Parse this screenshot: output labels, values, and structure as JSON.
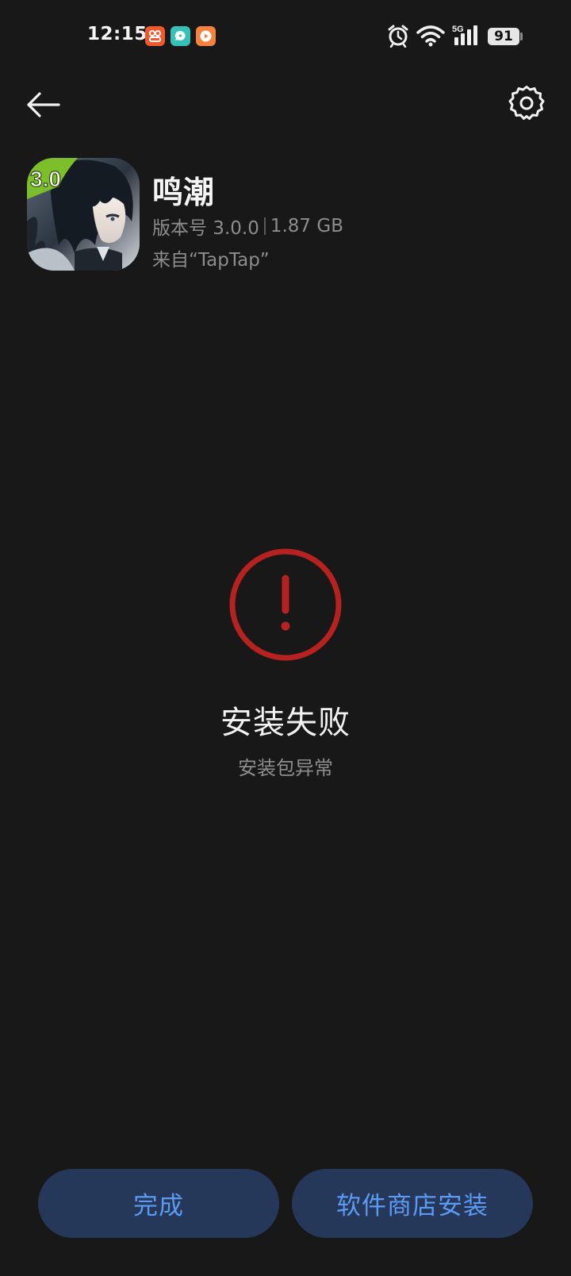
{
  "status_bar": {
    "time": "12:15",
    "network": "5G",
    "battery": "91",
    "notification_icons": [
      "app-notification-icon",
      "chat-notification-icon",
      "video-notification-icon"
    ]
  },
  "toolbar": {
    "back_icon": "arrow-left-icon",
    "settings_icon": "gear-icon"
  },
  "app": {
    "name": "鸣潮",
    "version": "版本号 3.0.0",
    "size": "1.87 GB",
    "source": "来自“TapTap”",
    "icon_badge": "3.0"
  },
  "status": {
    "title": "安装失败",
    "detail": "安装包异常",
    "icon": "error-exclamation-icon",
    "color": "#b5221f"
  },
  "actions": {
    "done_label": "完成",
    "store_install_label": "软件商店安装",
    "button_bg": "#26385a",
    "button_text_color": "#5b9bf4"
  }
}
